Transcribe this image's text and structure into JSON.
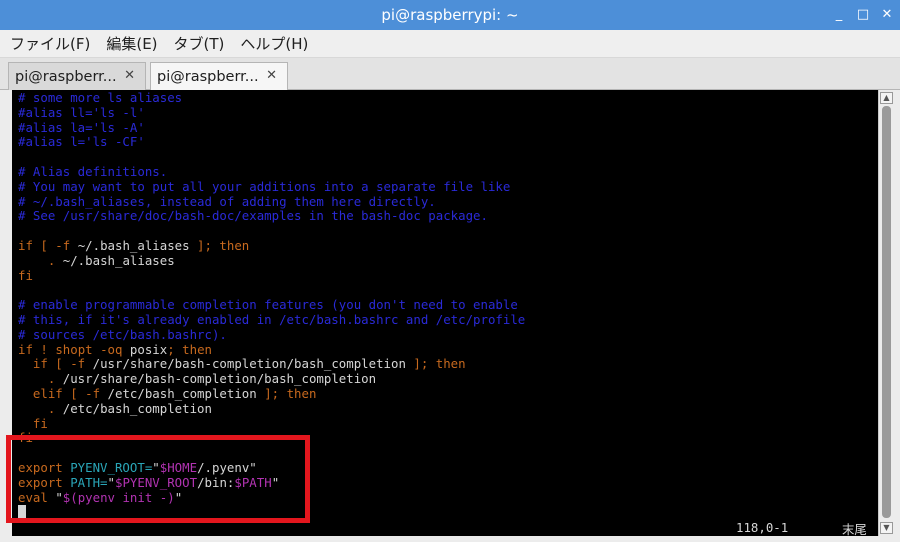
{
  "window": {
    "title": "pi@raspberrypi: ~",
    "buttons": {
      "minimize": "_",
      "maximize": "□",
      "close": "✕"
    }
  },
  "menu": [
    "ファイル(F)",
    "編集(E)",
    "タブ(T)",
    "ヘルプ(H)"
  ],
  "tabs": [
    {
      "label": "pi@raspberr...",
      "close": "✕",
      "active": false
    },
    {
      "label": "pi@raspberr...",
      "close": "✕",
      "active": true
    }
  ],
  "terminal": {
    "lines": [
      [
        {
          "t": "# some more ls aliases",
          "c": "cm"
        }
      ],
      [
        {
          "t": "#alias ll='ls -l'",
          "c": "cm"
        }
      ],
      [
        {
          "t": "#alias la='ls -A'",
          "c": "cm"
        }
      ],
      [
        {
          "t": "#alias l='ls -CF'",
          "c": "cm"
        }
      ],
      [],
      [
        {
          "t": "# Alias definitions.",
          "c": "cm"
        }
      ],
      [
        {
          "t": "# You may want to put all your additions into a separate file like",
          "c": "cm"
        }
      ],
      [
        {
          "t": "# ~/.bash_aliases, instead of adding them here directly.",
          "c": "cm"
        }
      ],
      [
        {
          "t": "# See /usr/share/doc/bash-doc/examples in the bash-doc package.",
          "c": "cm"
        }
      ],
      [],
      [
        {
          "t": "if [ -f ",
          "c": "kw"
        },
        {
          "t": "~/.bash_aliases",
          "c": "tx"
        },
        {
          "t": " ]; then",
          "c": "kw"
        }
      ],
      [
        {
          "t": "    . ",
          "c": "kw"
        },
        {
          "t": "~/.bash_aliases",
          "c": "tx"
        }
      ],
      [
        {
          "t": "fi",
          "c": "kw"
        }
      ],
      [],
      [
        {
          "t": "# enable programmable completion features (you don't need to enable",
          "c": "cm"
        }
      ],
      [
        {
          "t": "# this, if it's already enabled in /etc/bash.bashrc and /etc/profile",
          "c": "cm"
        }
      ],
      [
        {
          "t": "# sources /etc/bash.bashrc).",
          "c": "cm"
        }
      ],
      [
        {
          "t": "if ! ",
          "c": "kw"
        },
        {
          "t": "shopt -oq ",
          "c": "kw"
        },
        {
          "t": "posix",
          "c": "tx"
        },
        {
          "t": "; then",
          "c": "kw"
        }
      ],
      [
        {
          "t": "  if [ -f ",
          "c": "kw"
        },
        {
          "t": "/usr/share/bash-completion/bash_completion",
          "c": "tx"
        },
        {
          "t": " ]; then",
          "c": "kw"
        }
      ],
      [
        {
          "t": "    . ",
          "c": "kw"
        },
        {
          "t": "/usr/share/bash-completion/bash_completion",
          "c": "tx"
        }
      ],
      [
        {
          "t": "  elif [ -f ",
          "c": "kw"
        },
        {
          "t": "/etc/bash_completion",
          "c": "tx"
        },
        {
          "t": " ]; then",
          "c": "kw"
        }
      ],
      [
        {
          "t": "    . ",
          "c": "kw"
        },
        {
          "t": "/etc/bash_completion",
          "c": "tx"
        }
      ],
      [
        {
          "t": "  fi",
          "c": "kw"
        }
      ],
      [
        {
          "t": "fi",
          "c": "kw"
        }
      ],
      [],
      [
        {
          "t": "export ",
          "c": "kw"
        },
        {
          "t": "PYENV_ROOT=",
          "c": "cy"
        },
        {
          "t": "\"",
          "c": "tx"
        },
        {
          "t": "$HOME",
          "c": "mg"
        },
        {
          "t": "/.pyenv\"",
          "c": "tx"
        }
      ],
      [
        {
          "t": "export ",
          "c": "kw"
        },
        {
          "t": "PATH=",
          "c": "cy"
        },
        {
          "t": "\"",
          "c": "tx"
        },
        {
          "t": "$PYENV_ROOT",
          "c": "mg"
        },
        {
          "t": "/bin:",
          "c": "tx"
        },
        {
          "t": "$PATH",
          "c": "mg"
        },
        {
          "t": "\"",
          "c": "tx"
        }
      ],
      [
        {
          "t": "eval ",
          "c": "kw"
        },
        {
          "t": "\"",
          "c": "tx"
        },
        {
          "t": "$(pyenv init -)",
          "c": "mg"
        },
        {
          "t": "\"",
          "c": "tx"
        }
      ]
    ],
    "status_position": "118,0-1",
    "status_scroll": "末尾"
  },
  "colors": {
    "titlebar": "#4d8fd8",
    "terminal_bg": "#000000",
    "comment": "#2a2ad8",
    "keyword": "#c7691e",
    "text": "#d6d6d6",
    "variable": "#2aa6b8",
    "expansion": "#b233b2",
    "highlight_box": "#e3161d"
  },
  "icons": {
    "scroll_up": "chevron-up-icon",
    "scroll_down": "chevron-down-icon"
  }
}
